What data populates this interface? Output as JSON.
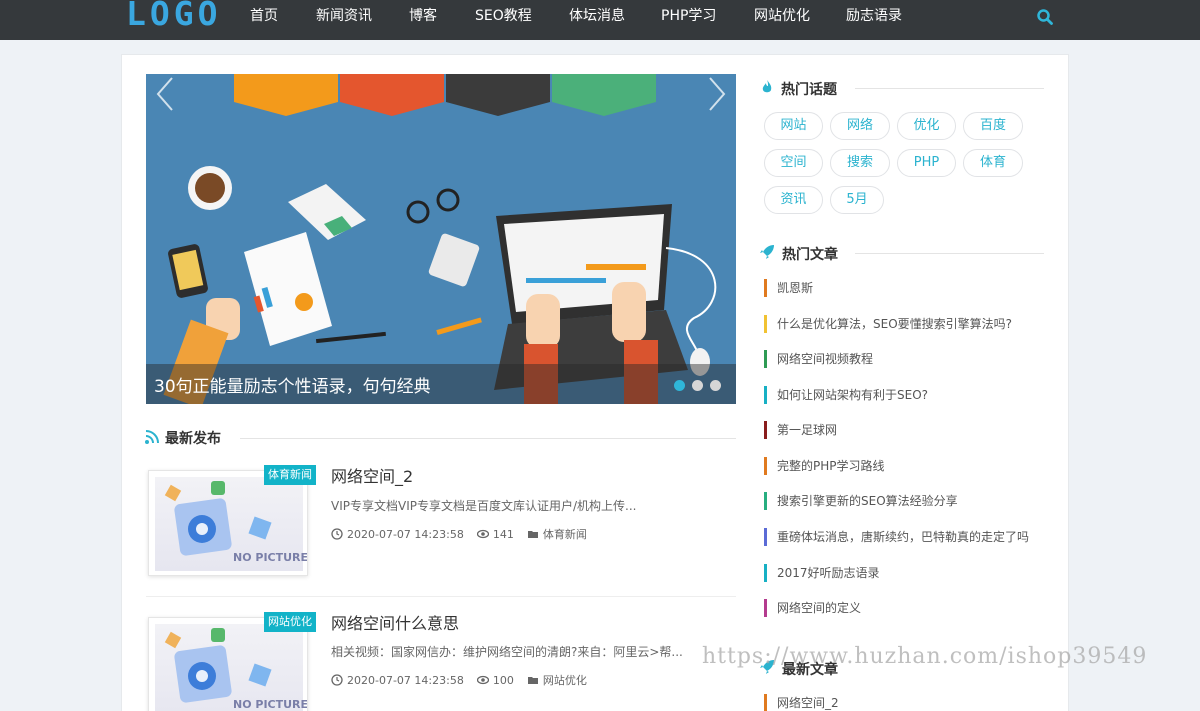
{
  "header": {
    "logo": "LOGO",
    "nav": [
      "首页",
      "新闻资讯",
      "博客",
      "SEO教程",
      "体坛消息",
      "PHP学习",
      "网站优化",
      "励志语录"
    ]
  },
  "slider": {
    "caption": "30句正能量励志个性语录，句句经典",
    "dots": 3,
    "active_dot": 0
  },
  "latest": {
    "title": "最新发布",
    "posts": [
      {
        "badge": "体育新闻",
        "thumb_text": "NO PICTURE",
        "title": "网络空间_2",
        "excerpt": "VIP专享文档VIP专享文档是百度文库认证用户/机构上传...",
        "date": "2020-07-07 14:23:58",
        "views": "141",
        "category": "体育新闻"
      },
      {
        "badge": "网站优化",
        "thumb_text": "NO PICTURE",
        "title": "网络空间什么意思",
        "excerpt": "相关视频：国家网信办：维护网络空间的清朗?来自：阿里云>帮...",
        "date": "2020-07-07 14:23:58",
        "views": "100",
        "category": "网站优化"
      }
    ]
  },
  "hot_topics": {
    "title": "热门话题",
    "tags": [
      "网站",
      "网络",
      "优化",
      "百度",
      "空间",
      "搜索",
      "PHP",
      "体育",
      "资讯",
      "5月"
    ]
  },
  "hot_articles": {
    "title": "热门文章",
    "items": [
      {
        "label": "凯恩斯",
        "color": "#e07a1f"
      },
      {
        "label": "什么是优化算法，SEO要懂搜索引擎算法吗?",
        "color": "#f1c232"
      },
      {
        "label": "网络空间视频教程",
        "color": "#2e9b54"
      },
      {
        "label": "如何让网站架构有利于SEO?",
        "color": "#17b0c4"
      },
      {
        "label": "第一足球网",
        "color": "#8a1d1d"
      },
      {
        "label": "完整的PHP学习路线",
        "color": "#e07a1f"
      },
      {
        "label": "搜索引擎更新的SEO算法经验分享",
        "color": "#27ae80"
      },
      {
        "label": "重磅体坛消息，唐斯续约，巴特勒真的走定了吗",
        "color": "#5b6bd6"
      },
      {
        "label": "2017好听励志语录",
        "color": "#17b0c4"
      },
      {
        "label": "网络空间的定义",
        "color": "#b43b8e"
      }
    ]
  },
  "newest_articles": {
    "title": "最新文章",
    "items": [
      {
        "label": "网络空间_2",
        "color": "#e07a1f"
      }
    ]
  },
  "watermark": "https://www.huzhan.com/ishop39549",
  "colors": {
    "accent": "#2bb3cf",
    "topbar": "#35393c",
    "logo": "#3aa7e0"
  }
}
